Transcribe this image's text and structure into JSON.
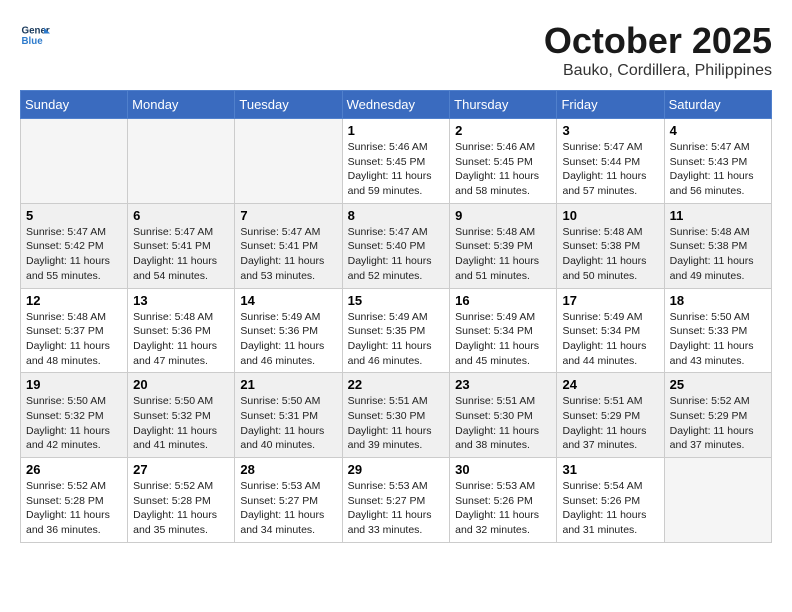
{
  "header": {
    "logo_line1": "General",
    "logo_line2": "Blue",
    "month": "October 2025",
    "location": "Bauko, Cordillera, Philippines"
  },
  "weekdays": [
    "Sunday",
    "Monday",
    "Tuesday",
    "Wednesday",
    "Thursday",
    "Friday",
    "Saturday"
  ],
  "weeks": [
    [
      {
        "day": "",
        "sunrise": "",
        "sunset": "",
        "daylight": ""
      },
      {
        "day": "",
        "sunrise": "",
        "sunset": "",
        "daylight": ""
      },
      {
        "day": "",
        "sunrise": "",
        "sunset": "",
        "daylight": ""
      },
      {
        "day": "1",
        "sunrise": "Sunrise: 5:46 AM",
        "sunset": "Sunset: 5:45 PM",
        "daylight": "Daylight: 11 hours and 59 minutes."
      },
      {
        "day": "2",
        "sunrise": "Sunrise: 5:46 AM",
        "sunset": "Sunset: 5:45 PM",
        "daylight": "Daylight: 11 hours and 58 minutes."
      },
      {
        "day": "3",
        "sunrise": "Sunrise: 5:47 AM",
        "sunset": "Sunset: 5:44 PM",
        "daylight": "Daylight: 11 hours and 57 minutes."
      },
      {
        "day": "4",
        "sunrise": "Sunrise: 5:47 AM",
        "sunset": "Sunset: 5:43 PM",
        "daylight": "Daylight: 11 hours and 56 minutes."
      }
    ],
    [
      {
        "day": "5",
        "sunrise": "Sunrise: 5:47 AM",
        "sunset": "Sunset: 5:42 PM",
        "daylight": "Daylight: 11 hours and 55 minutes."
      },
      {
        "day": "6",
        "sunrise": "Sunrise: 5:47 AM",
        "sunset": "Sunset: 5:41 PM",
        "daylight": "Daylight: 11 hours and 54 minutes."
      },
      {
        "day": "7",
        "sunrise": "Sunrise: 5:47 AM",
        "sunset": "Sunset: 5:41 PM",
        "daylight": "Daylight: 11 hours and 53 minutes."
      },
      {
        "day": "8",
        "sunrise": "Sunrise: 5:47 AM",
        "sunset": "Sunset: 5:40 PM",
        "daylight": "Daylight: 11 hours and 52 minutes."
      },
      {
        "day": "9",
        "sunrise": "Sunrise: 5:48 AM",
        "sunset": "Sunset: 5:39 PM",
        "daylight": "Daylight: 11 hours and 51 minutes."
      },
      {
        "day": "10",
        "sunrise": "Sunrise: 5:48 AM",
        "sunset": "Sunset: 5:38 PM",
        "daylight": "Daylight: 11 hours and 50 minutes."
      },
      {
        "day": "11",
        "sunrise": "Sunrise: 5:48 AM",
        "sunset": "Sunset: 5:38 PM",
        "daylight": "Daylight: 11 hours and 49 minutes."
      }
    ],
    [
      {
        "day": "12",
        "sunrise": "Sunrise: 5:48 AM",
        "sunset": "Sunset: 5:37 PM",
        "daylight": "Daylight: 11 hours and 48 minutes."
      },
      {
        "day": "13",
        "sunrise": "Sunrise: 5:48 AM",
        "sunset": "Sunset: 5:36 PM",
        "daylight": "Daylight: 11 hours and 47 minutes."
      },
      {
        "day": "14",
        "sunrise": "Sunrise: 5:49 AM",
        "sunset": "Sunset: 5:36 PM",
        "daylight": "Daylight: 11 hours and 46 minutes."
      },
      {
        "day": "15",
        "sunrise": "Sunrise: 5:49 AM",
        "sunset": "Sunset: 5:35 PM",
        "daylight": "Daylight: 11 hours and 46 minutes."
      },
      {
        "day": "16",
        "sunrise": "Sunrise: 5:49 AM",
        "sunset": "Sunset: 5:34 PM",
        "daylight": "Daylight: 11 hours and 45 minutes."
      },
      {
        "day": "17",
        "sunrise": "Sunrise: 5:49 AM",
        "sunset": "Sunset: 5:34 PM",
        "daylight": "Daylight: 11 hours and 44 minutes."
      },
      {
        "day": "18",
        "sunrise": "Sunrise: 5:50 AM",
        "sunset": "Sunset: 5:33 PM",
        "daylight": "Daylight: 11 hours and 43 minutes."
      }
    ],
    [
      {
        "day": "19",
        "sunrise": "Sunrise: 5:50 AM",
        "sunset": "Sunset: 5:32 PM",
        "daylight": "Daylight: 11 hours and 42 minutes."
      },
      {
        "day": "20",
        "sunrise": "Sunrise: 5:50 AM",
        "sunset": "Sunset: 5:32 PM",
        "daylight": "Daylight: 11 hours and 41 minutes."
      },
      {
        "day": "21",
        "sunrise": "Sunrise: 5:50 AM",
        "sunset": "Sunset: 5:31 PM",
        "daylight": "Daylight: 11 hours and 40 minutes."
      },
      {
        "day": "22",
        "sunrise": "Sunrise: 5:51 AM",
        "sunset": "Sunset: 5:30 PM",
        "daylight": "Daylight: 11 hours and 39 minutes."
      },
      {
        "day": "23",
        "sunrise": "Sunrise: 5:51 AM",
        "sunset": "Sunset: 5:30 PM",
        "daylight": "Daylight: 11 hours and 38 minutes."
      },
      {
        "day": "24",
        "sunrise": "Sunrise: 5:51 AM",
        "sunset": "Sunset: 5:29 PM",
        "daylight": "Daylight: 11 hours and 37 minutes."
      },
      {
        "day": "25",
        "sunrise": "Sunrise: 5:52 AM",
        "sunset": "Sunset: 5:29 PM",
        "daylight": "Daylight: 11 hours and 37 minutes."
      }
    ],
    [
      {
        "day": "26",
        "sunrise": "Sunrise: 5:52 AM",
        "sunset": "Sunset: 5:28 PM",
        "daylight": "Daylight: 11 hours and 36 minutes."
      },
      {
        "day": "27",
        "sunrise": "Sunrise: 5:52 AM",
        "sunset": "Sunset: 5:28 PM",
        "daylight": "Daylight: 11 hours and 35 minutes."
      },
      {
        "day": "28",
        "sunrise": "Sunrise: 5:53 AM",
        "sunset": "Sunset: 5:27 PM",
        "daylight": "Daylight: 11 hours and 34 minutes."
      },
      {
        "day": "29",
        "sunrise": "Sunrise: 5:53 AM",
        "sunset": "Sunset: 5:27 PM",
        "daylight": "Daylight: 11 hours and 33 minutes."
      },
      {
        "day": "30",
        "sunrise": "Sunrise: 5:53 AM",
        "sunset": "Sunset: 5:26 PM",
        "daylight": "Daylight: 11 hours and 32 minutes."
      },
      {
        "day": "31",
        "sunrise": "Sunrise: 5:54 AM",
        "sunset": "Sunset: 5:26 PM",
        "daylight": "Daylight: 11 hours and 31 minutes."
      },
      {
        "day": "",
        "sunrise": "",
        "sunset": "",
        "daylight": ""
      }
    ]
  ]
}
